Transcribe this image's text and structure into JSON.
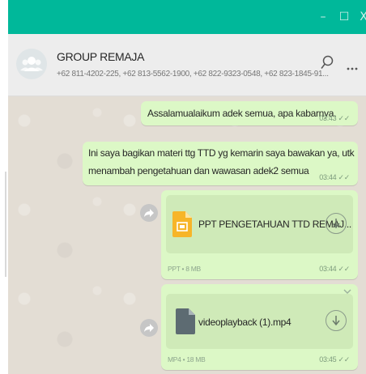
{
  "window": {
    "minimize_glyph": "–",
    "maximize_glyph": "☐",
    "close_glyph": "X"
  },
  "chat_header": {
    "title": "GROUP REMAJA",
    "participants": "+62 811-4202-225, +62 813-5562-1900, +62 822-9323-0548, +62 823-1845-91...",
    "search_icon": "search-icon",
    "menu_icon": "more-options-icon"
  },
  "messages": [
    {
      "type": "text",
      "text": "Assalamualaikum adek semua, apa kabarnya.",
      "time": "03:43",
      "status": "delivered"
    },
    {
      "type": "text",
      "line1": "Ini saya bagikan materi ttg TTD yg kemarin saya bawakan ya, utk",
      "line2": "menambah pengetahuan dan wawasan adek2 semua",
      "time": "03:44",
      "status": "delivered"
    },
    {
      "type": "file",
      "filename": "PPT PENGETAHUAN TTD REMAJ...",
      "meta": "PPT • 8 MB",
      "time": "03:44",
      "status": "delivered",
      "icon": "ppt-file-icon"
    },
    {
      "type": "file",
      "filename": "videoplayback (1).mp4",
      "meta": "MP4 • 18 MB",
      "time": "03:45",
      "status": "delivered",
      "icon": "file-icon"
    }
  ],
  "tick_glyph": "✓✓",
  "colors": {
    "titlebar": "#00b89a",
    "outgoing_bubble": "#dcf8c6",
    "chat_background": "#e3ddd4"
  }
}
